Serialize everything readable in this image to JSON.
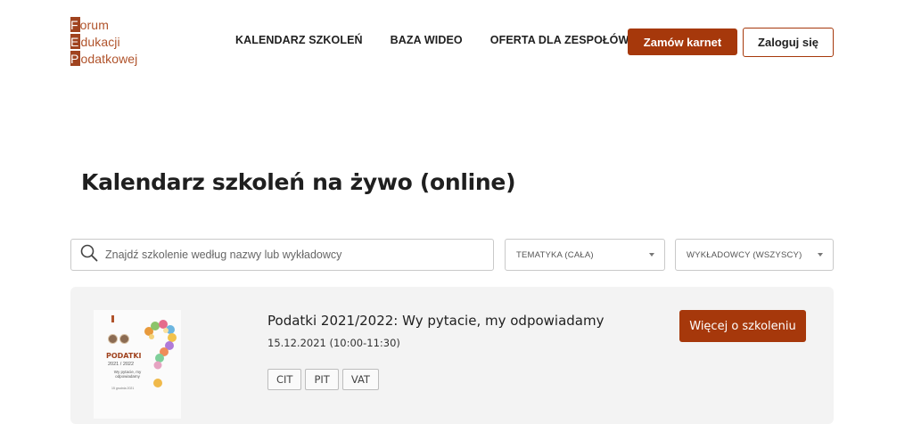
{
  "logo": {
    "lines": [
      {
        "first": "F",
        "rest": "orum"
      },
      {
        "first": "E",
        "rest": "dukacji"
      },
      {
        "first": "P",
        "rest": "odatkowej"
      }
    ],
    "color": "#a0431f"
  },
  "nav": {
    "items": [
      "KALENDARZ SZKOLEŃ",
      "BAZA WIDEO",
      "OFERTA DLA ZESPOŁÓW"
    ]
  },
  "header": {
    "order_label": "Zamów karnet",
    "login_label": "Zaloguj się"
  },
  "page": {
    "title": "Kalendarz szkoleń na żywo (online)"
  },
  "filters": {
    "search_placeholder": "Znajdź szkolenie według nazwy lub wykładowcy",
    "topic_selected": "TEMATYKA (CAŁA)",
    "lecturer_selected": "WYKŁADOWCY (WSZYSCY)"
  },
  "trainings": [
    {
      "title": "Podatki 2021/2022: Wy pytacie, my odpowiadamy",
      "date": "15.12.2021 (10:00-11:30)",
      "tags": [
        "CIT",
        "PIT",
        "VAT"
      ],
      "more_label": "Więcej o szkoleniu",
      "thumb": {
        "title": "PODATKI",
        "years": "2021 / 2022",
        "subtitle": "Wy pytacie, my odpowiadamy",
        "date": "15 grudnia 2021"
      }
    }
  ],
  "colors": {
    "accent": "#a6380b",
    "card_bg": "#f3f3f3"
  }
}
